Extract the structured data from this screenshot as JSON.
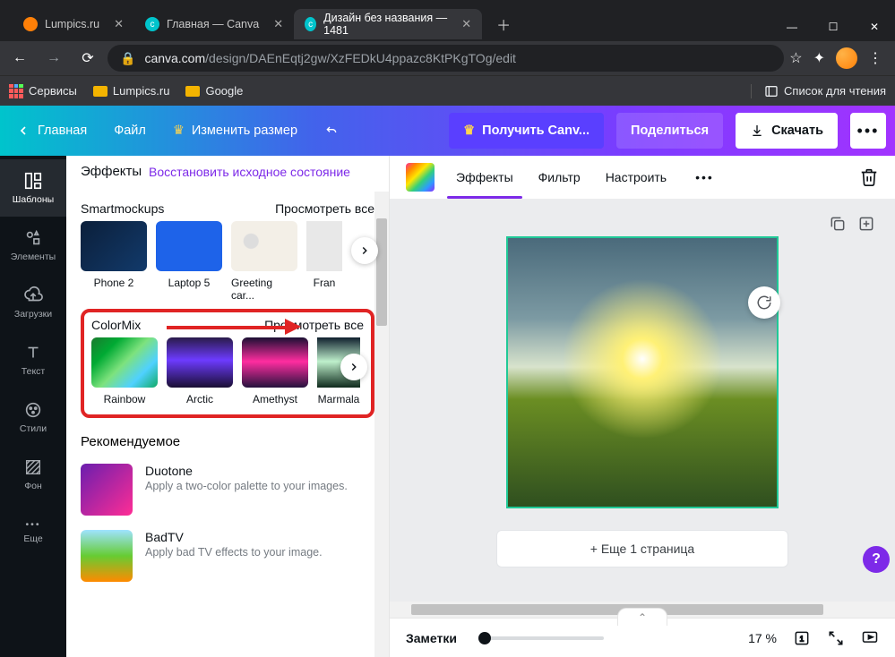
{
  "browser": {
    "tabs": [
      {
        "title": "Lumpics.ru",
        "favColor": "#ff8008"
      },
      {
        "title": "Главная — Canva",
        "favColor": "#00c4cc"
      },
      {
        "title": "Дизайн без названия — 1481",
        "favColor": "#00c4cc"
      }
    ],
    "url_domain": "canva.com",
    "url_path": "/design/DAEnEqtj2gw/XzFEDkU4ppazc8KtPKgTOg/edit",
    "bookmarks": {
      "services": "Сервисы",
      "items": [
        "Lumpics.ru",
        "Google"
      ],
      "reading_list": "Список для чтения"
    }
  },
  "top": {
    "home": "Главная",
    "file": "Файл",
    "resize": "Изменить размер",
    "get_pro": "Получить Canv...",
    "share": "Поделиться",
    "download": "Скачать"
  },
  "rail": {
    "templates": "Шаблоны",
    "elements": "Элементы",
    "uploads": "Загрузки",
    "text": "Текст",
    "styles": "Стили",
    "background": "Фон",
    "more": "Еще"
  },
  "panel": {
    "title": "Эффекты",
    "restore": "Восстановить исходное состояние",
    "smartmockups": {
      "title": "Smartmockups",
      "all": "Просмотреть все",
      "items": [
        "Phone 2",
        "Laptop 5",
        "Greeting car...",
        "Fran"
      ]
    },
    "colormix": {
      "title": "ColorMix",
      "all": "Просмотреть все",
      "items": [
        "Rainbow",
        "Arctic",
        "Amethyst",
        "Marmala"
      ]
    },
    "recommended": {
      "title": "Рекомендуемое",
      "duotone": {
        "name": "Duotone",
        "desc": "Apply a two-color palette to your images."
      },
      "badtv": {
        "name": "BadTV",
        "desc": "Apply bad TV effects to your image."
      }
    }
  },
  "ctx": {
    "effects": "Эффекты",
    "filter": "Фильтр",
    "adjust": "Настроить"
  },
  "canvas": {
    "add_page": "+ Еще 1 страница"
  },
  "bottom": {
    "notes": "Заметки",
    "zoom": "17 %"
  }
}
